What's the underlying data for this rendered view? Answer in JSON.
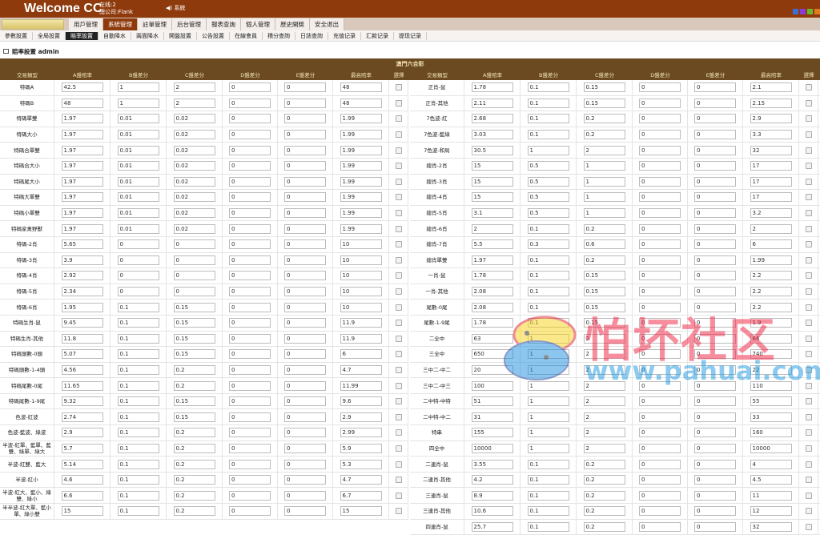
{
  "header": {
    "welcome": "Welcome CC",
    "online": "在线:2",
    "company": "總公司:Flank",
    "sound": "◀) 系統",
    "swatches": [
      "#3a6fd8",
      "#8a3ad8",
      "#6ab82a",
      "#e07a20"
    ]
  },
  "nav": {
    "items": [
      "用戶管理",
      "系統管理",
      "註單管理",
      "后台管理",
      "報表查詢",
      "個人管理",
      "歷史開獎",
      "安全退出"
    ],
    "active": 1
  },
  "subnav": {
    "items": [
      "參數設置",
      "全局設置",
      "賠率設置",
      "自動降水",
      "兩面降水",
      "開盤設置",
      "公告設置",
      "在線會員",
      "積分查詢",
      "日誌查詢",
      "充值记录",
      "汇款记录",
      "提现记录"
    ],
    "active": 2
  },
  "page_title": "賠率設置 admin",
  "table": {
    "caption": "澳門六合彩",
    "columns": [
      "交易類型",
      "A盤賠率",
      "B盤差分",
      "C盤差分",
      "D盤差分",
      "E盤差分",
      "最高賠率",
      "選擇"
    ],
    "left": [
      [
        "特碼A",
        "42.5",
        "1",
        "2",
        "0",
        "0",
        "48"
      ],
      [
        "特碼B",
        "48",
        "1",
        "2",
        "0",
        "0",
        "48"
      ],
      [
        "特碼單雙",
        "1.97",
        "0.01",
        "0.02",
        "0",
        "0",
        "1.99"
      ],
      [
        "特碼大小",
        "1.97",
        "0.01",
        "0.02",
        "0",
        "0",
        "1.99"
      ],
      [
        "特碼合單雙",
        "1.97",
        "0.01",
        "0.02",
        "0",
        "0",
        "1.99"
      ],
      [
        "特碼合大小",
        "1.97",
        "0.01",
        "0.02",
        "0",
        "0",
        "1.99"
      ],
      [
        "特碼尾大小",
        "1.97",
        "0.01",
        "0.02",
        "0",
        "0",
        "1.99"
      ],
      [
        "特碼大單雙",
        "1.97",
        "0.01",
        "0.02",
        "0",
        "0",
        "1.99"
      ],
      [
        "特碼小單雙",
        "1.97",
        "0.01",
        "0.02",
        "0",
        "0",
        "1.99"
      ],
      [
        "特碼家禽野獸",
        "1.97",
        "0.01",
        "0.02",
        "0",
        "0",
        "1.99"
      ],
      [
        "特碼-2肖",
        "5.65",
        "0",
        "0",
        "0",
        "0",
        "10"
      ],
      [
        "特碼-3肖",
        "3.9",
        "0",
        "0",
        "0",
        "0",
        "10"
      ],
      [
        "特碼-4肖",
        "2.92",
        "0",
        "0",
        "0",
        "0",
        "10"
      ],
      [
        "特碼-5肖",
        "2.34",
        "0",
        "0",
        "0",
        "0",
        "10"
      ],
      [
        "特碼-6肖",
        "1.95",
        "0.1",
        "0.15",
        "0",
        "0",
        "10"
      ],
      [
        "特碼生肖-鼠",
        "9.45",
        "0.1",
        "0.15",
        "0",
        "0",
        "11.9"
      ],
      [
        "特碼生肖-其他",
        "11.8",
        "0.1",
        "0.15",
        "0",
        "0",
        "11.9"
      ],
      [
        "特碼頭數-0頭",
        "5.07",
        "0.1",
        "0.15",
        "0",
        "0",
        "6"
      ],
      [
        "特碼頭數-1-4頭",
        "4.56",
        "0.1",
        "0.2",
        "0",
        "0",
        "4.7"
      ],
      [
        "特碼尾數-0尾",
        "11.65",
        "0.1",
        "0.2",
        "0",
        "0",
        "11.99"
      ],
      [
        "特碼尾數-1-9尾",
        "9.32",
        "0.1",
        "0.15",
        "0",
        "0",
        "9.6"
      ],
      [
        "色波-紅波",
        "2.74",
        "0.1",
        "0.15",
        "0",
        "0",
        "2.9"
      ],
      [
        "色波-藍波、綠波",
        "2.9",
        "0.1",
        "0.2",
        "0",
        "0",
        "2.99"
      ],
      [
        "半波-紅單、藍單、藍雙、綠單、綠大",
        "5.7",
        "0.1",
        "0.2",
        "0",
        "0",
        "5.9"
      ],
      [
        "半波-紅雙、藍大",
        "5.14",
        "0.1",
        "0.2",
        "0",
        "0",
        "5.3"
      ],
      [
        "半波-紅小",
        "4.6",
        "0.1",
        "0.2",
        "0",
        "0",
        "4.7"
      ],
      [
        "半波-紅大、藍小、綠雙、綠小",
        "6.6",
        "0.1",
        "0.2",
        "0",
        "0",
        "6.7"
      ],
      [
        "半半波-紅大單、藍小單、綠小雙",
        "15",
        "0.1",
        "0.2",
        "0",
        "0",
        "15"
      ]
    ],
    "right": [
      [
        "正肖-鼠",
        "1.78",
        "0.1",
        "0.15",
        "0",
        "0",
        "2.1"
      ],
      [
        "正肖-其他",
        "2.11",
        "0.1",
        "0.15",
        "0",
        "0",
        "2.15"
      ],
      [
        "7色波-紅",
        "2.68",
        "0.1",
        "0.2",
        "0",
        "0",
        "2.9"
      ],
      [
        "7色波-藍綠",
        "3.03",
        "0.1",
        "0.2",
        "0",
        "0",
        "3.3"
      ],
      [
        "7色波-和局",
        "30.5",
        "1",
        "2",
        "0",
        "0",
        "32"
      ],
      [
        "總肖-2肖",
        "15",
        "0.5",
        "1",
        "0",
        "0",
        "17"
      ],
      [
        "總肖-3肖",
        "15",
        "0.5",
        "1",
        "0",
        "0",
        "17"
      ],
      [
        "總肖-4肖",
        "15",
        "0.5",
        "1",
        "0",
        "0",
        "17"
      ],
      [
        "總肖-5肖",
        "3.1",
        "0.5",
        "1",
        "0",
        "0",
        "3.2"
      ],
      [
        "總肖-6肖",
        "2",
        "0.1",
        "0.2",
        "0",
        "0",
        "2"
      ],
      [
        "總肖-7肖",
        "5.5",
        "0.3",
        "0.6",
        "0",
        "0",
        "6"
      ],
      [
        "總肖單雙",
        "1.97",
        "0.1",
        "0.2",
        "0",
        "0",
        "1.99"
      ],
      [
        "一肖-鼠",
        "1.78",
        "0.1",
        "0.15",
        "0",
        "0",
        "2.2"
      ],
      [
        "一肖-其他",
        "2.08",
        "0.1",
        "0.15",
        "0",
        "0",
        "2.2"
      ],
      [
        "尾數-0尾",
        "2.08",
        "0.1",
        "0.15",
        "0",
        "0",
        "2.2"
      ],
      [
        "尾數-1-9尾",
        "1.78",
        "0.1",
        "0.15",
        "0",
        "0",
        "1.9"
      ],
      [
        "二全中",
        "63",
        "1",
        "2",
        "0",
        "0",
        "66"
      ],
      [
        "三全中",
        "650",
        "1",
        "2",
        "0",
        "0",
        "740"
      ],
      [
        "三中二-中二",
        "20",
        "1",
        "2",
        "0",
        "0",
        "22"
      ],
      [
        "三中二-中三",
        "100",
        "1",
        "2",
        "0",
        "0",
        "110"
      ],
      [
        "二中特-中特",
        "51",
        "1",
        "2",
        "0",
        "0",
        "55"
      ],
      [
        "二中特-中二",
        "31",
        "1",
        "2",
        "0",
        "0",
        "33"
      ],
      [
        "特串",
        "155",
        "1",
        "2",
        "0",
        "0",
        "160"
      ],
      [
        "四全中",
        "10000",
        "1",
        "2",
        "0",
        "0",
        "10000"
      ],
      [
        "二連肖-鼠",
        "3.55",
        "0.1",
        "0.2",
        "0",
        "0",
        "4"
      ],
      [
        "二連肖-其他",
        "4.2",
        "0.1",
        "0.2",
        "0",
        "0",
        "4.5"
      ],
      [
        "三連肖-鼠",
        "8.9",
        "0.1",
        "0.2",
        "0",
        "0",
        "11"
      ],
      [
        "三連肖-其他",
        "10.6",
        "0.1",
        "0.2",
        "0",
        "0",
        "12"
      ],
      [
        "四連肖-鼠",
        "25.7",
        "0.1",
        "0.2",
        "0",
        "0",
        "32"
      ]
    ]
  },
  "watermark": {
    "name": "怕坏社区",
    "url": "www.pahuai.com"
  }
}
